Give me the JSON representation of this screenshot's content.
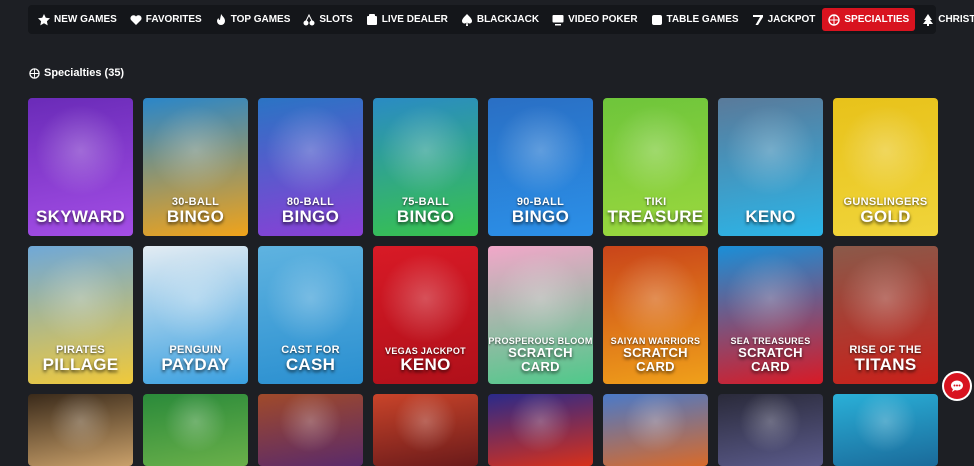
{
  "nav": {
    "items": [
      {
        "label": "NEW GAMES",
        "icon": "star-icon"
      },
      {
        "label": "FAVORITES",
        "icon": "heart-icon"
      },
      {
        "label": "TOP GAMES",
        "icon": "flame-icon"
      },
      {
        "label": "SLOTS",
        "icon": "cherries-icon"
      },
      {
        "label": "LIVE DEALER",
        "icon": "dealer-icon"
      },
      {
        "label": "BLACKJACK",
        "icon": "spade-icon"
      },
      {
        "label": "VIDEO POKER",
        "icon": "monitor-icon"
      },
      {
        "label": "TABLE GAMES",
        "icon": "dice-icon"
      },
      {
        "label": "JACKPOT",
        "icon": "seven-icon"
      },
      {
        "label": "SPECIALTIES",
        "icon": "ball-icon"
      },
      {
        "label": "CHRISTMAS",
        "icon": "tree-icon"
      }
    ],
    "active_color": "#d8131f"
  },
  "section": {
    "title": "Specialties (35)"
  },
  "games": [
    {
      "line1": "",
      "line2": "SKYWARD",
      "bg": "#6a2bb8",
      "bg2": "#a44ee6"
    },
    {
      "line1": "30-BALL",
      "line2": "BINGO",
      "bg": "#2a86c9",
      "bg2": "#f0a31a"
    },
    {
      "line1": "80-BALL",
      "line2": "BINGO",
      "bg": "#2a74c4",
      "bg2": "#8a3fd6"
    },
    {
      "line1": "75-BALL",
      "line2": "BINGO",
      "bg": "#2a8bc4",
      "bg2": "#37c24d"
    },
    {
      "line1": "90-BALL",
      "line2": "BINGO",
      "bg": "#2a6fc4",
      "bg2": "#2b90e8"
    },
    {
      "line1": "TIKI",
      "line2": "TREASURE",
      "bg": "#6ec53b",
      "bg2": "#9bd83e"
    },
    {
      "line1": "",
      "line2": "KENO",
      "bg": "#5a7a9a",
      "bg2": "#2bb5e8"
    },
    {
      "line1": "GUNSLINGERS",
      "line2": "GOLD",
      "bg": "#e8c21a",
      "bg2": "#f0d43a"
    },
    {
      "line1": "PIRATES",
      "line2": "PILLAGE",
      "bg": "#6fa8d8",
      "bg2": "#f0c93a"
    },
    {
      "line1": "PENGUIN",
      "line2": "PAYDAY",
      "bg": "#e3ecf3",
      "bg2": "#3aa0e0"
    },
    {
      "line1": "CAST FOR",
      "line2": "CASH",
      "bg": "#5fb3e0",
      "bg2": "#2a8fd0"
    },
    {
      "line1": "VEGAS JACKPOT",
      "line2": "KENO",
      "bg": "#d81a26",
      "bg2": "#b0101a"
    },
    {
      "line1": "PROSPEROUS BLOOM",
      "line2": "SCRATCH CARD",
      "bg": "#f2a7c9",
      "bg2": "#4fc98a"
    },
    {
      "line1": "SAIYAN WARRIORS",
      "line2": "SCRATCH CARD",
      "bg": "#c9441a",
      "bg2": "#f0a01a"
    },
    {
      "line1": "SEA TREASURES",
      "line2": "SCRATCH CARD",
      "bg": "#1a8fd8",
      "bg2": "#d81a26"
    },
    {
      "line1": "RISE OF THE",
      "line2": "TITANS",
      "bg": "#8a5a4a",
      "bg2": "#c9201a"
    },
    {
      "line1": "",
      "line2": "",
      "bg": "#3a2a1a",
      "bg2": "#c9a06a"
    },
    {
      "line1": "",
      "line2": "",
      "bg": "#2a8a3a",
      "bg2": "#6ab04a"
    },
    {
      "line1": "",
      "line2": "",
      "bg": "#a04a2a",
      "bg2": "#5a2a6a"
    },
    {
      "line1": "",
      "line2": "",
      "bg": "#c9442a",
      "bg2": "#6a1a1a"
    },
    {
      "line1": "",
      "line2": "",
      "bg": "#2a2a8a",
      "bg2": "#d8301a"
    },
    {
      "line1": "",
      "line2": "",
      "bg": "#4a7ac9",
      "bg2": "#d86a2a"
    },
    {
      "line1": "",
      "line2": "",
      "bg": "#2a2a3a",
      "bg2": "#5a5a8a"
    },
    {
      "line1": "",
      "line2": "",
      "bg": "#2ab0d8",
      "bg2": "#1a6a9a"
    }
  ]
}
